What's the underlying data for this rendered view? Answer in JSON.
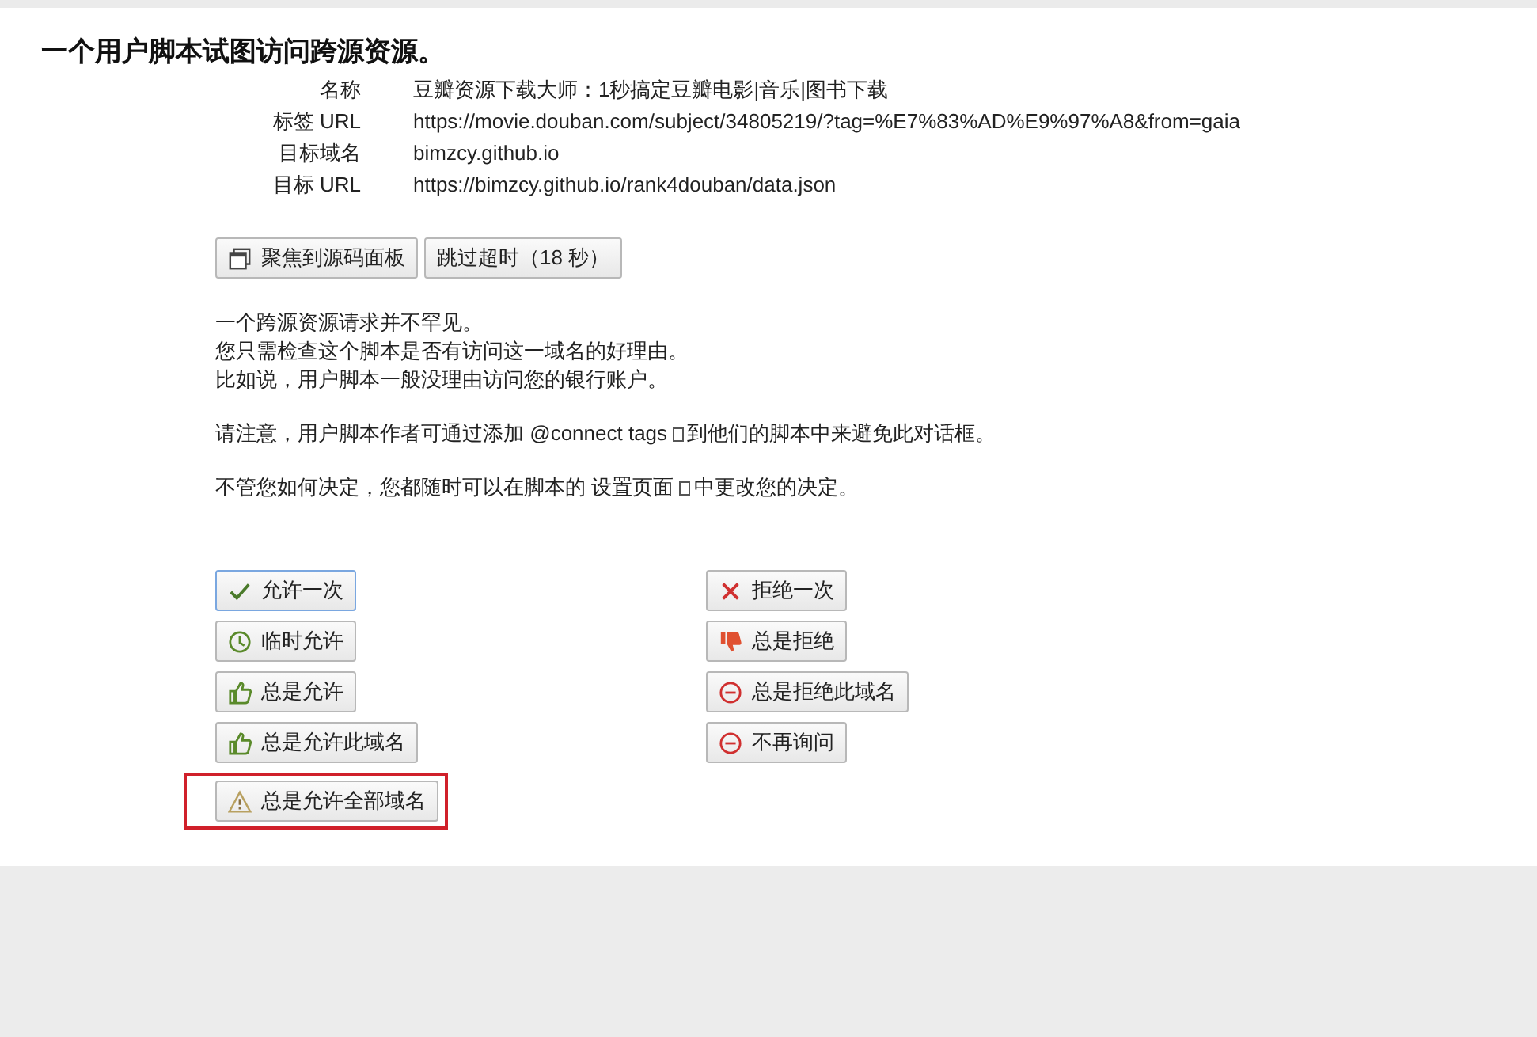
{
  "title": "一个用户脚本试图访问跨源资源。",
  "info": [
    {
      "label": "名称",
      "value": "豆瓣资源下载大师：1秒搞定豆瓣电影|音乐|图书下载"
    },
    {
      "label": "标签 URL",
      "value": "https://movie.douban.com/subject/34805219/?tag=%E7%83%AD%E9%97%A8&from=gaia"
    },
    {
      "label": "目标域名",
      "value": "bimzcy.github.io"
    },
    {
      "label": "目标 URL",
      "value": "https://bimzcy.github.io/rank4douban/data.json"
    }
  ],
  "top_buttons": [
    {
      "label": "聚焦到源码面板",
      "kind": "window"
    },
    {
      "label": "跳过超时（18 秒）",
      "kind": "none"
    }
  ],
  "message_lines": [
    "一个跨源资源请求并不罕见。",
    "您只需检查这个脚本是否有访问这一域名的好理由。",
    "比如说，用户脚本一般没理由访问您的银行账户。"
  ],
  "note": {
    "before": "请注意，用户脚本作者可通过添加",
    "link": "@connect tags",
    "after": "到他们的脚本中来避免此对话框。"
  },
  "settings_note": {
    "before": "不管您如何决定，您都随时可以在脚本的",
    "link": "设置页面",
    "after": "中更改您的决定。"
  },
  "allow_buttons": [
    {
      "label": "允许一次",
      "kind": "check",
      "focused": true,
      "highlighted": false
    },
    {
      "label": "临时允许",
      "kind": "clock",
      "focused": false,
      "highlighted": false
    },
    {
      "label": "总是允许",
      "kind": "thumbs-up",
      "focused": false,
      "highlighted": false
    },
    {
      "label": "总是允许此域名",
      "kind": "thumbs-up",
      "focused": false,
      "highlighted": false
    },
    {
      "label": "总是允许全部域名",
      "kind": "warning",
      "focused": false,
      "highlighted": true
    }
  ],
  "deny_buttons": [
    {
      "label": "拒绝一次",
      "kind": "x",
      "focused": false,
      "highlighted": false
    },
    {
      "label": "总是拒绝",
      "kind": "thumbs-down",
      "focused": false,
      "highlighted": false
    },
    {
      "label": "总是拒绝此域名",
      "kind": "minus-circle",
      "focused": false,
      "highlighted": false
    },
    {
      "label": "不再询问",
      "kind": "minus-circle",
      "focused": false,
      "highlighted": false
    }
  ]
}
